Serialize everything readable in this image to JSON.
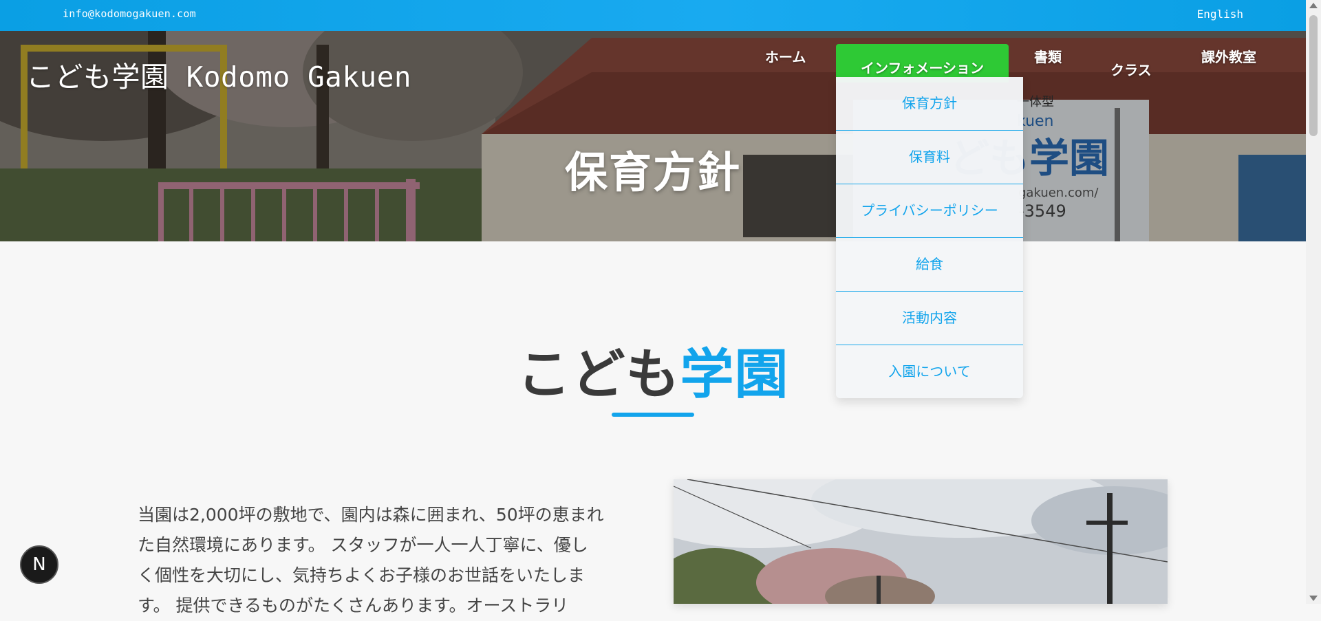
{
  "topbar": {
    "email": "info@kodomogakuen.com",
    "language": "English"
  },
  "header": {
    "brand": "こども学園 Kodomo Gakuen",
    "nav": {
      "home": "ホーム",
      "information": "インフォメーション",
      "documents": "書類",
      "classes": "クラス",
      "extracurricular": "課外教室"
    },
    "page_title": "保育方針",
    "hero_sign": {
      "line1": "一体型",
      "line2": "kuen",
      "line3": "ども学園",
      "line4": "gakuen.com/",
      "line5": "-3549"
    }
  },
  "dropdown": {
    "items": [
      "保育方針",
      "保育料",
      "プライバシーポリシー",
      "給食",
      "活動内容",
      "入園について"
    ]
  },
  "main": {
    "heading_part1": "こども",
    "heading_part2": "学園",
    "paragraph_lines": [
      "当園は2,000坪の敷地で、園内は森に囲まれ、50坪の恵まれ",
      "た自然環境にあります。 スタッフが一人一人丁寧に、優し",
      "く個性を大切にし、気持ちよくお子様のお世話をいたしま",
      "す。 提供できるものがたくさんあります。オーストラリ"
    ]
  },
  "badge": {
    "letter": "N"
  },
  "colors": {
    "topbar": "#0aa3e8",
    "accent_blue": "#12a4ec",
    "active_nav_green": "#2ec935",
    "heading_dark": "#3a3a3a"
  }
}
